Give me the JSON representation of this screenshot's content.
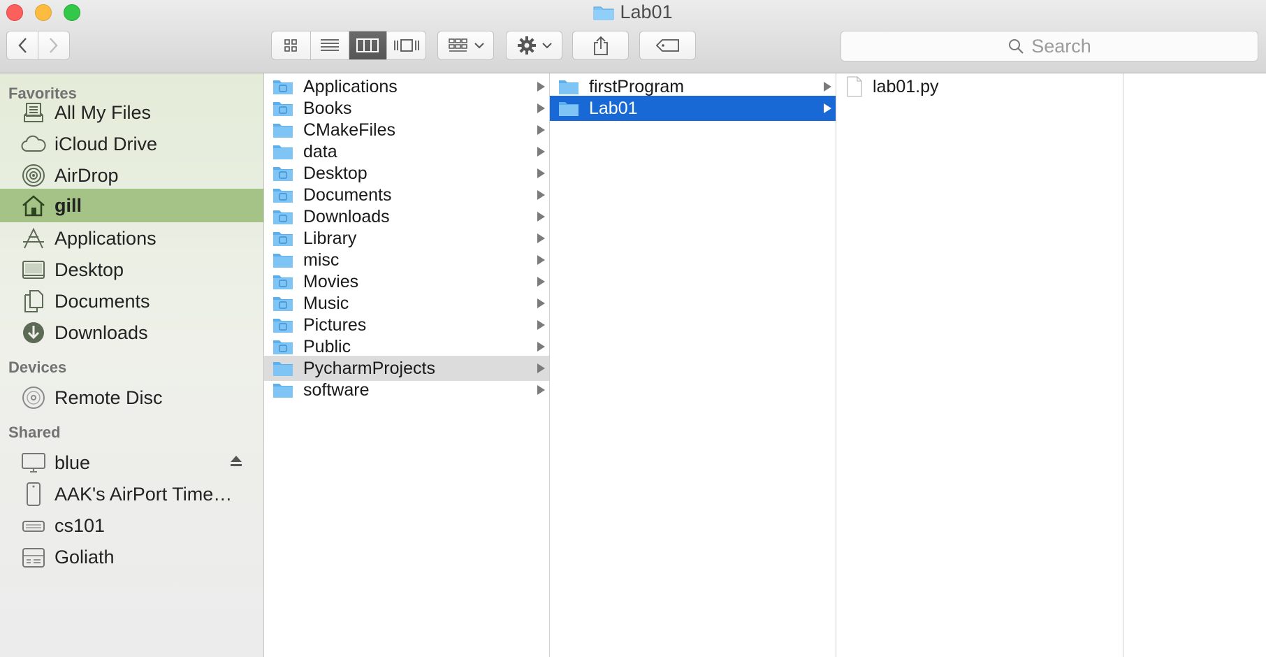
{
  "window": {
    "title": "Lab01"
  },
  "toolbar": {
    "search_placeholder": "Search",
    "view_buttons": [
      "icon-view",
      "list-view",
      "column-view",
      "cover-flow-view"
    ]
  },
  "sidebar": {
    "favorites_heading": "Favorites",
    "favorites": [
      {
        "label": "All My Files",
        "icon": "all-files-icon"
      },
      {
        "label": "iCloud Drive",
        "icon": "cloud-icon"
      },
      {
        "label": "AirDrop",
        "icon": "airdrop-icon"
      },
      {
        "label": "gill",
        "icon": "home-icon",
        "selected": true
      },
      {
        "label": "Applications",
        "icon": "applications-icon"
      },
      {
        "label": "Desktop",
        "icon": "desktop-icon"
      },
      {
        "label": "Documents",
        "icon": "documents-icon"
      },
      {
        "label": "Downloads",
        "icon": "downloads-icon"
      }
    ],
    "devices_heading": "Devices",
    "devices": [
      {
        "label": "Remote Disc",
        "icon": "disc-icon"
      }
    ],
    "shared_heading": "Shared",
    "shared": [
      {
        "label": "blue",
        "icon": "monitor-icon"
      },
      {
        "label": "AAK's AirPort Time…",
        "icon": "airport-icon"
      },
      {
        "label": "cs101",
        "icon": "server-icon"
      },
      {
        "label": "Goliath",
        "icon": "server-icon"
      }
    ]
  },
  "columns": {
    "col1": [
      "Applications",
      "Books",
      "CMakeFiles",
      "data",
      "Desktop",
      "Documents",
      "Downloads",
      "Library",
      "misc",
      "Movies",
      "Music",
      "Pictures",
      "Public",
      "PycharmProjects",
      "software"
    ],
    "col1_selected": "PycharmProjects",
    "col2": [
      "firstProgram",
      "Lab01"
    ],
    "col2_selected": "Lab01",
    "col3": [
      "lab01.py"
    ]
  },
  "colors": {
    "selection_blue": "#1869d5",
    "sidebar_selected": "#a5c386",
    "folder": "#7ec4f5"
  }
}
